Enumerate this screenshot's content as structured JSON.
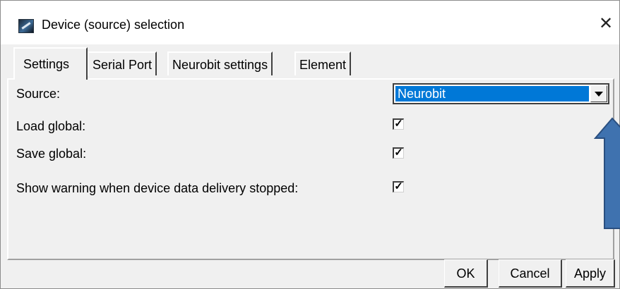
{
  "window": {
    "title": "Device (source) selection",
    "close_glyph": "✕",
    "icon": "app-logo-icon"
  },
  "tabs": [
    {
      "label": "Settings",
      "active": true
    },
    {
      "label": "Serial Port",
      "active": false
    },
    {
      "label": "Neurobit settings",
      "active": false
    },
    {
      "label": "Element",
      "active": false
    }
  ],
  "settings": {
    "source": {
      "label": "Source:",
      "value": "Neurobit"
    },
    "load_global": {
      "label": "Load global:",
      "checked": true
    },
    "save_global": {
      "label": "Save global:",
      "checked": true
    },
    "show_warning": {
      "label": "Show warning when device data delivery stopped:",
      "checked": true
    }
  },
  "check_glyph": "✓",
  "buttons": {
    "ok": "OK",
    "cancel": "Cancel",
    "apply": "Apply"
  },
  "colors": {
    "selection": "#0078d7",
    "annotation_arrow": "#3f72af",
    "annotation_arrow_outline": "#2a4f80"
  }
}
